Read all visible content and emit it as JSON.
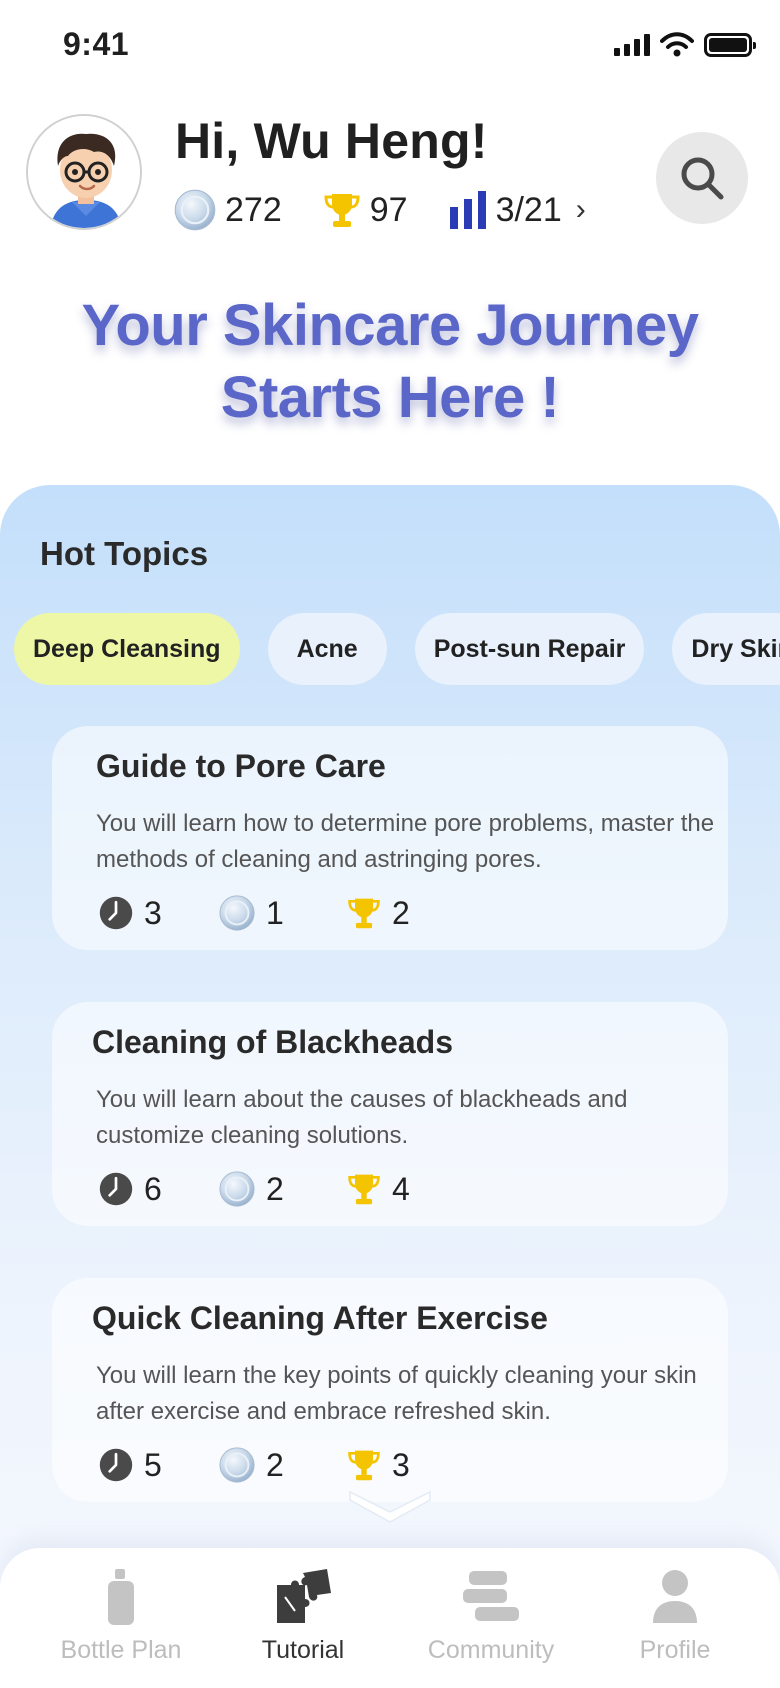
{
  "status_bar": {
    "time": "9:41"
  },
  "header": {
    "greeting": "Hi, Wu Heng!",
    "coins": "272",
    "trophies": "97",
    "level": "3/21",
    "search_icon": "search-icon"
  },
  "hero": {
    "line1": "Your Skincare Journey",
    "line2": "Starts Here !"
  },
  "hot_topics": {
    "title": "Hot Topics",
    "chips": [
      "Deep Cleansing",
      "Acne",
      "Post-sun Repair",
      "Dry Skin"
    ],
    "active_chip": "Deep Cleansing"
  },
  "cards": [
    {
      "title": "Guide to Pore Care",
      "description": "You will learn how to determine pore problems, master the methods of cleaning and astringing pores.",
      "time": "3",
      "coins": "1",
      "trophies": "2"
    },
    {
      "title": "Cleaning of Blackheads",
      "description": "You will learn about the causes of blackheads and customize cleaning solutions.",
      "time": "6",
      "coins": "2",
      "trophies": "4"
    },
    {
      "title": "Quick Cleaning After Exercise",
      "description": "You will learn the key points of quickly cleaning your skin after exercise and embrace refreshed skin.",
      "time": "5",
      "coins": "2",
      "trophies": "3"
    }
  ],
  "bottom_nav": {
    "items": [
      "Bottle Plan",
      "Tutorial",
      "Community",
      "Profile"
    ],
    "active": "Tutorial"
  },
  "colors": {
    "accent": "#5b66c9",
    "active_chip": "#eef7a5",
    "trophy": "#f5c400",
    "level_bars": "#2b3bb5"
  }
}
